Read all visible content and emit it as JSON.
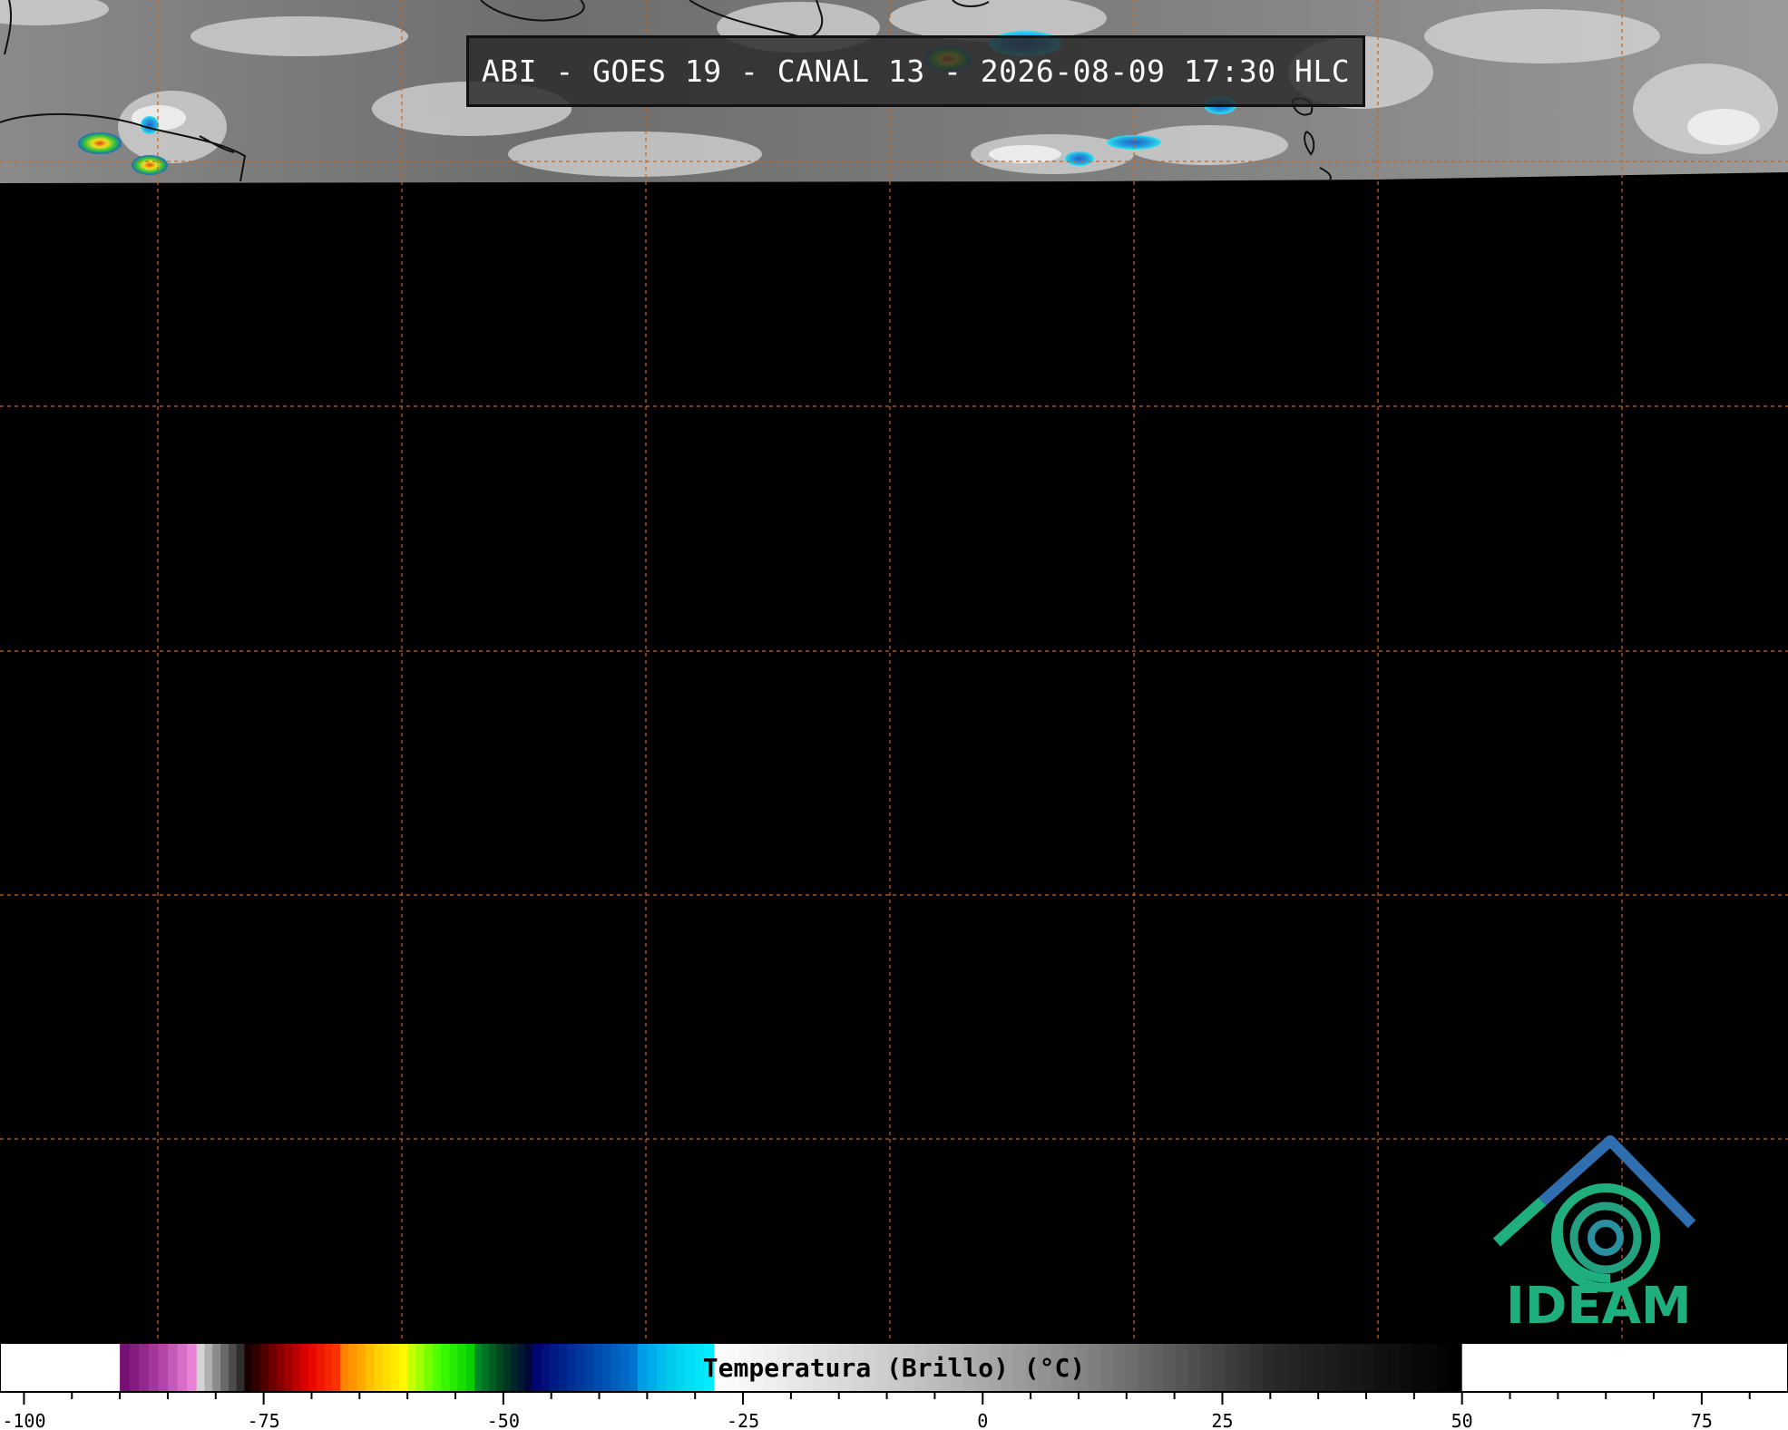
{
  "title": "ABI - GOES 19 - CANAL 13 - 2026-08-09 17:30 HLC",
  "colorbar": {
    "label": "Temperatura (Brillo) (°C)",
    "ticks": [
      "-100",
      "-75",
      "-50",
      "-25",
      "0",
      "25",
      "50",
      "75"
    ],
    "range": [
      -102.5,
      84
    ]
  },
  "logo": {
    "text": "IDEAM"
  },
  "colors": {
    "grid": "#c8661e",
    "background": "#000000",
    "logo_green": "#1fae7e",
    "logo_blue": "#2f6fb0"
  }
}
